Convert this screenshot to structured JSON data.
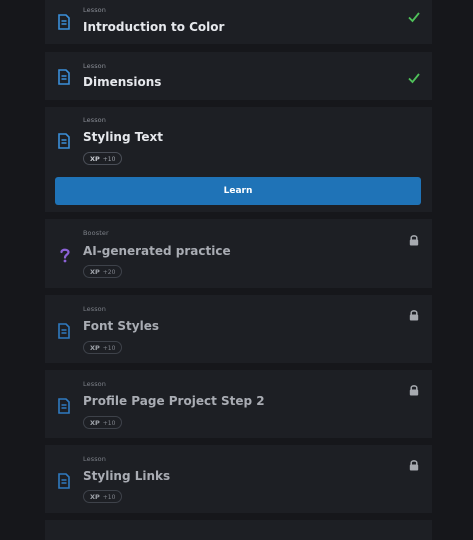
{
  "items": [
    {
      "kind": "Lesson",
      "title": "Introduction to Color",
      "status": "completed",
      "icon": "lesson-doc-icon"
    },
    {
      "kind": "Lesson",
      "title": "Dimensions",
      "status": "completed",
      "icon": "lesson-doc-icon"
    },
    {
      "kind": "Lesson",
      "title": "Styling Text",
      "status": "current",
      "icon": "lesson-doc-icon",
      "xp_label": "XP",
      "xp_value": "+10",
      "button_label": "Learn"
    },
    {
      "kind": "Booster",
      "title": "AI-generated practice",
      "status": "locked",
      "icon": "question-mark-icon",
      "xp_label": "XP",
      "xp_value": "+20"
    },
    {
      "kind": "Lesson",
      "title": "Font Styles",
      "status": "locked",
      "icon": "lesson-doc-icon",
      "xp_label": "XP",
      "xp_value": "+10"
    },
    {
      "kind": "Lesson",
      "title": "Profile Page Project Step 2",
      "status": "locked",
      "icon": "lesson-doc-icon",
      "xp_label": "XP",
      "xp_value": "+10"
    },
    {
      "kind": "Lesson",
      "title": "Styling Links",
      "status": "locked",
      "icon": "lesson-doc-icon",
      "xp_label": "XP",
      "xp_value": "+10"
    }
  ],
  "colors": {
    "background": "#16171b",
    "card": "#1d1f24",
    "accent_blue": "#1f73b7",
    "check_green": "#4fc15a",
    "lock_gray": "#a7aab0",
    "booster_purple": "#8c62d6"
  }
}
